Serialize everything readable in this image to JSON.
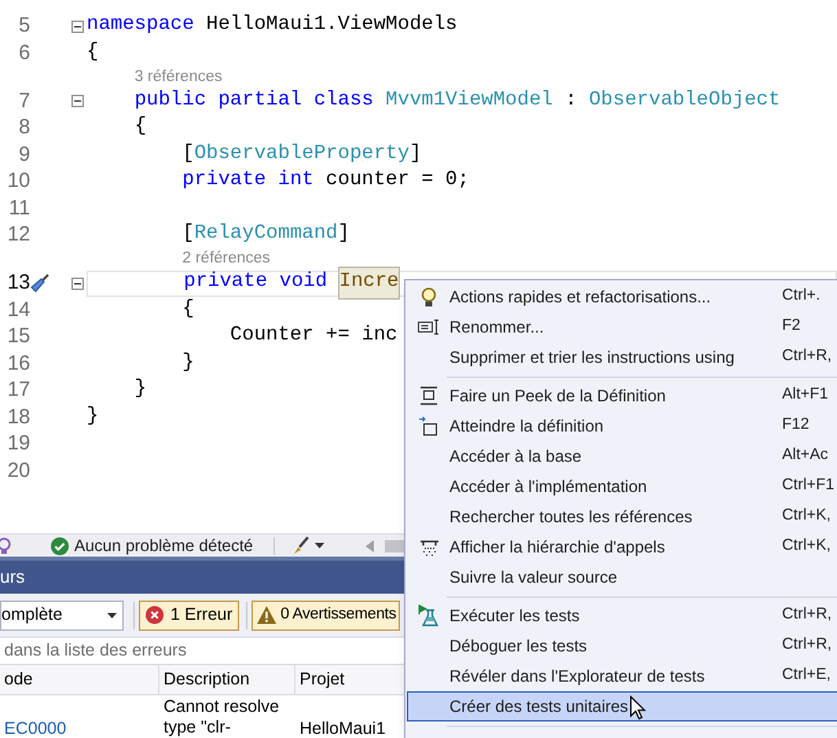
{
  "editor": {
    "lines": [
      {
        "kind": "code",
        "number": "5",
        "fold": true,
        "current": false,
        "tokens": [
          {
            "text": "namespace",
            "kind": "keyword"
          },
          {
            "text": " HelloMaui1.ViewModels",
            "kind": "plain"
          }
        ]
      },
      {
        "kind": "code",
        "number": "6",
        "fold": false,
        "current": false,
        "tokens": [
          {
            "text": "{",
            "kind": "plain"
          }
        ],
        "children": [
          {
            "kind": "codelens",
            "text": "3 références"
          },
          {
            "kind": "code",
            "number": "7",
            "fold": true,
            "current": false,
            "tokens": [
              {
                "text": "public partial class",
                "kind": "keyword"
              },
              {
                "text": " Mvvm1ViewModel",
                "kind": "type"
              },
              {
                "text": " :",
                "kind": "plain"
              },
              {
                "text": " ObservableObject",
                "kind": "type"
              }
            ]
          },
          {
            "kind": "code",
            "number": "8",
            "fold": false,
            "current": false,
            "tokens": [
              {
                "text": "{",
                "kind": "plain"
              }
            ],
            "children": [
              {
                "kind": "code",
                "number": "9",
                "fold": false,
                "current": false,
                "tokens": [
                  {
                    "text": "[",
                    "kind": "plain"
                  },
                  {
                    "text": "ObservableProperty",
                    "kind": "type"
                  },
                  {
                    "text": "]",
                    "kind": "plain"
                  }
                ]
              },
              {
                "kind": "code",
                "number": "10",
                "fold": false,
                "current": false,
                "tokens": [
                  {
                    "text": "private int",
                    "kind": "keyword"
                  },
                  {
                    "text": " counter = 0;",
                    "kind": "plain"
                  }
                ]
              },
              {
                "kind": "code",
                "number": "11",
                "fold": false,
                "current": false
              },
              {
                "kind": "code",
                "number": "12",
                "fold": false,
                "current": false,
                "tokens": [
                  {
                    "text": "[",
                    "kind": "plain"
                  },
                  {
                    "text": "RelayCommand",
                    "kind": "type"
                  },
                  {
                    "text": "]",
                    "kind": "plain"
                  }
                ]
              },
              {
                "kind": "codelens",
                "text": "2 références"
              },
              {
                "kind": "code",
                "number": "13",
                "fold": true,
                "current": true,
                "tokens": [
                  {
                    "text": "private void ",
                    "kind": "keyword"
                  },
                  {
                    "text": "Incre",
                    "kind": "highlight"
                  }
                ]
              },
              {
                "kind": "code",
                "number": "14",
                "fold": false,
                "current": false,
                "tokens": [
                  {
                    "text": "{",
                    "kind": "plain"
                  }
                ],
                "children": [
                  {
                    "kind": "code",
                    "number": "15",
                    "fold": false,
                    "current": false,
                    "tokens": [
                      {
                        "text": "Counter += inc",
                        "kind": "plain"
                      }
                    ]
                  }
                ]
              },
              {
                "kind": "code",
                "number": "16",
                "fold": false,
                "current": false,
                "tokens": [
                  {
                    "text": "}",
                    "kind": "plain"
                  }
                ]
              }
            ]
          },
          {
            "kind": "code",
            "number": "17",
            "fold": false,
            "current": false,
            "tokens": [
              {
                "text": "}",
                "kind": "plain"
              }
            ]
          }
        ]
      },
      {
        "kind": "code",
        "number": "18",
        "fold": false,
        "current": false,
        "tokens": [
          {
            "text": "}",
            "kind": "plain"
          }
        ]
      },
      {
        "kind": "code",
        "number": "19",
        "fold": false,
        "current": false
      },
      {
        "kind": "code",
        "number": "20",
        "fold": false,
        "current": false
      }
    ]
  },
  "status_bar": {
    "message": "Aucun problème détecté"
  },
  "error_list": {
    "title": "urs",
    "scope": "omplète",
    "errors": "1 Erreur",
    "warnings": "0 Avertissements",
    "search": {
      "placeholder": "dans la liste des erreurs"
    },
    "columns": [
      "ode",
      "Description",
      "Projet"
    ],
    "rows": [
      {
        "code": "EC0000",
        "description": "Cannot resolve type \"clr-",
        "project": "HelloMaui1"
      }
    ]
  },
  "context_menu": {
    "items": [
      {
        "kind": "bulb",
        "label": "Actions rapides et refactorisations...",
        "shortcut": "Ctrl+.",
        "selected": false
      },
      {
        "kind": "rename",
        "label": "Renommer...",
        "shortcut": "F2",
        "selected": false
      },
      {
        "kind": "plain",
        "label": "Supprimer et trier les instructions using",
        "shortcut": "Ctrl+R,",
        "selected": false
      },
      {
        "kind": "separator"
      },
      {
        "kind": "peek",
        "label": "Faire un Peek de la Définition",
        "shortcut": "Alt+F1",
        "selected": false
      },
      {
        "kind": "goto",
        "label": "Atteindre la définition",
        "shortcut": "F12",
        "selected": false
      },
      {
        "kind": "plain",
        "label": "Accéder à la base",
        "shortcut": "Alt+Ac",
        "selected": false
      },
      {
        "kind": "plain",
        "label": "Accéder à l'implémentation",
        "shortcut": "Ctrl+F1",
        "selected": false
      },
      {
        "kind": "plain",
        "label": "Rechercher toutes les références",
        "shortcut": "Ctrl+K,",
        "selected": false
      },
      {
        "kind": "hierarchy",
        "label": "Afficher la hiérarchie d'appels",
        "shortcut": "Ctrl+K,",
        "selected": false
      },
      {
        "kind": "plain",
        "label": "Suivre la valeur source",
        "selected": false
      },
      {
        "kind": "separator"
      },
      {
        "kind": "tests",
        "label": "Exécuter les tests",
        "shortcut": "Ctrl+R,",
        "selected": false
      },
      {
        "kind": "plain",
        "label": "Déboguer les tests",
        "shortcut": "Ctrl+R,",
        "selected": false
      },
      {
        "kind": "plain",
        "label": "Révéler dans l'Explorateur de tests",
        "shortcut": "Ctrl+E,",
        "selected": false
      },
      {
        "kind": "plain",
        "label": "Créer des tests unitaires",
        "selected": true
      },
      {
        "kind": "separator"
      }
    ]
  }
}
